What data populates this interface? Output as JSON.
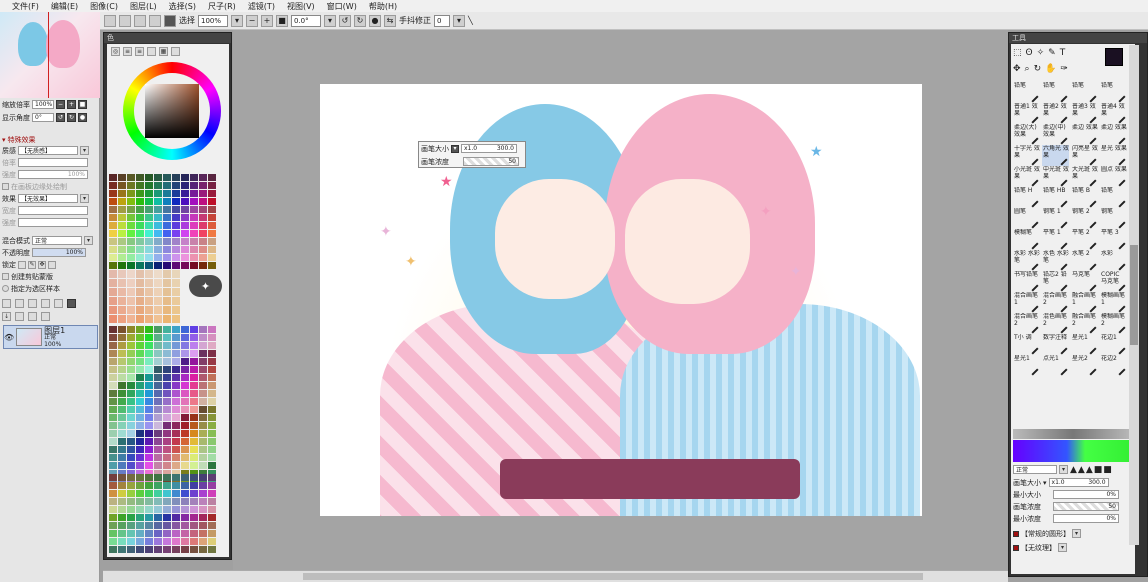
{
  "menu": [
    "文件(F)",
    "编辑(E)",
    "图像(C)",
    "图层(L)",
    "选择(S)",
    "尺子(R)",
    "滤镜(T)",
    "视图(V)",
    "窗口(W)",
    "帮助(H)"
  ],
  "toolbar": {
    "select_label": "选择",
    "zoom_value": "100%",
    "rotation_value": "0.0°",
    "stabilizer_label": "手抖修正",
    "stabilizer_value": "0"
  },
  "left_panel": {
    "zoom_label": "缩放倍率",
    "zoom_value": "100%",
    "angle_label": "显示角度",
    "angle_value": "0°",
    "effects_header": "特殊效果",
    "texture_label": "质感",
    "texture_value": "【无质感】",
    "scale_label": "倍率",
    "strength_label": "强度",
    "strength_value": "100%",
    "edge_label": "在画板边缘处绘制",
    "effect_label": "效果",
    "effect_value": "【无效果】",
    "width_label": "宽度",
    "intensity_label": "强度",
    "blend_label": "混合模式",
    "blend_value": "正常",
    "opacity_label": "不透明度",
    "opacity_value": "100%",
    "lock_label": "锁定",
    "clip_label": "创建剪贴蒙版",
    "sample_label": "指定为选区样本",
    "layer_name": "图层1",
    "layer_mode": "正常",
    "layer_opacity": "100%"
  },
  "color_panel": {
    "title": "色"
  },
  "brush_popup": {
    "size_label": "画笔大小",
    "size_mult": "x1.0",
    "size_value": "300.0",
    "density_label": "画笔浓度",
    "density_value": "50"
  },
  "tool_panel": {
    "title": "工具",
    "brushes": [
      "铅笔",
      "铅笔",
      "铅笔",
      "铅笔",
      "普通1 效果",
      "普通2 效果",
      "普通3 效果",
      "普通4 效果",
      "柔边(大) 效果",
      "柔边(中) 效果",
      "柔边 效果",
      "柔边 效果",
      "十字光 效果",
      "六角光 效果",
      "闪亮星 效果",
      "星光 效果",
      "小光斑 效果",
      "中光斑 效果",
      "大光斑 效果",
      "圆点 效果",
      "铅笔 H",
      "铅笔 HB",
      "铅笔 B",
      "铅笔",
      "圆笔",
      "钢笔 1",
      "钢笔 2",
      "钢笔",
      "模糊笔",
      "平笔 1",
      "平笔 2",
      "平笔 3",
      "水彩 水彩笔",
      "水色 水彩笔",
      "水笔 2",
      "水彩",
      "书写铅笔",
      "铅芯2 铅笔",
      "马克笔",
      "COPIC 马克笔",
      "混合画笔 1",
      "混合画笔 2",
      "融合画笔 1",
      "模糊画笔 1",
      "混合画笔 2",
      "混色画笔 2",
      "融合画笔 2",
      "模糊画笔 2",
      "T小 调",
      "数字注释",
      "星光1",
      "花边1",
      "星光1",
      "点光1",
      "星光2",
      "花边2"
    ],
    "blend_value": "正常",
    "brush_size_label": "画笔大小",
    "brush_size_mult": "x1.0",
    "brush_size_value": "300.0",
    "min_size_label": "最小大小",
    "min_size_value": "0%",
    "density_label": "画笔浓度",
    "density_value": "50",
    "min_density_label": "最小浓度",
    "min_density_value": "0%",
    "shape_label": "【常规的圆形】",
    "texture_label": "【无纹理】"
  }
}
